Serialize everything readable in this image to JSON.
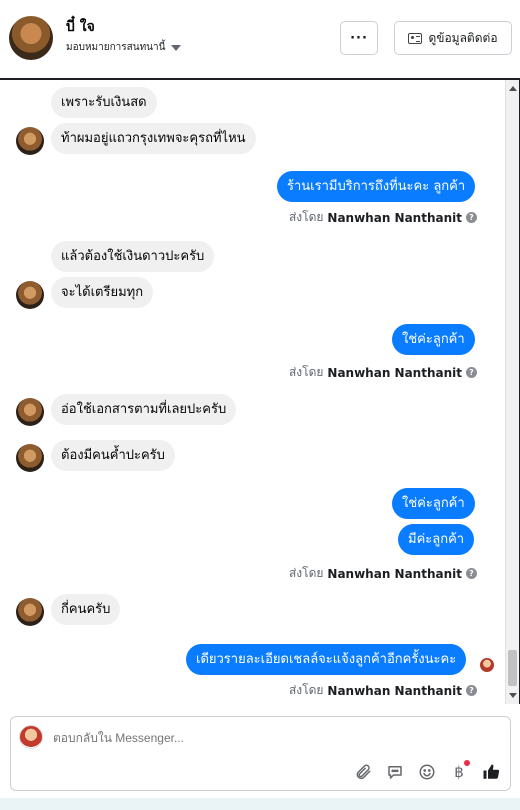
{
  "header": {
    "name": "บี๋ ใจ",
    "assign_label": "มอบหมายการสนทนานี้",
    "more_label": "···",
    "contact_label": "ดูข้อมูลติดต่อ"
  },
  "messages": [
    {
      "text": "เพราะรับเงินสด"
    },
    {
      "text": "ท้าผมอยู่แถวกรุงเทพจะคุรถที่ไหน"
    },
    {
      "text": "ร้านเรามีบริการถึงที่นะคะ ลูกค้า"
    },
    {
      "text": "แล้วต้องใช้เงินดาวปะครับ"
    },
    {
      "text": "จะได้เตรียมทุก"
    },
    {
      "text": "ใช่ค่ะลูกค้า"
    },
    {
      "text": "อ่อใช้เอกสารตามที่เลยปะครับ"
    },
    {
      "text": "ต้องมีคนค้ำปะครับ"
    },
    {
      "text": "ใช่ค่ะลูกค้า"
    },
    {
      "text": "มีค่ะลูกค้า"
    },
    {
      "text": "กี่คนครับ"
    },
    {
      "text": "เดียวรายละเอียดเชลล์จะแจ้งลูกค้าอีกครั้งนะคะ"
    }
  ],
  "sent_by": {
    "prefix": "ส่งโดย",
    "name": "Nanwhan Nanthanit",
    "help": "?"
  },
  "composer": {
    "placeholder": "ตอบกลับใน Messenger..."
  },
  "tools": {
    "attach_icon": "paperclip-icon",
    "chat_icon": "speech-bubble-icon",
    "emoji_icon": "smile-icon",
    "baht_label": "฿",
    "like_icon": "thumbs-up-icon"
  },
  "colors": {
    "outgoing_bubble": "#0a7cff",
    "incoming_bubble": "#f0f0f0"
  }
}
